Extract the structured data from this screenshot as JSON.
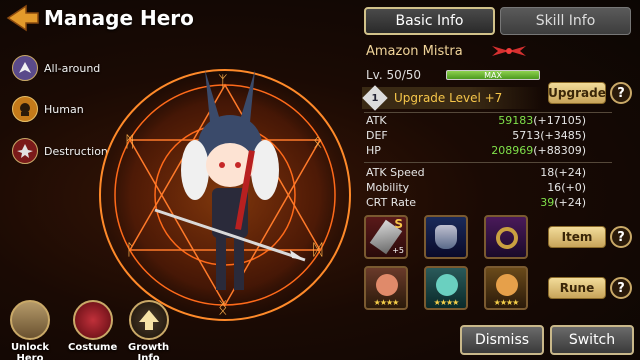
{
  "header": {
    "title": "Manage Hero"
  },
  "attributes": [
    {
      "label": "All-around",
      "icon": "wings-icon"
    },
    {
      "label": "Human",
      "icon": "human-head-icon"
    },
    {
      "label": "Destruction",
      "icon": "destruction-icon"
    }
  ],
  "bottom_buttons": [
    {
      "label": "Unlock\nHero",
      "icon": "lock-icon"
    },
    {
      "label": "Costume",
      "icon": "costume-icon"
    },
    {
      "label": "Growth\nInfo",
      "icon": "growth-arrow-icon"
    }
  ],
  "tabs": {
    "basic": "Basic Info",
    "skill": "Skill Info"
  },
  "hero": {
    "name": "Amazon Mistra",
    "level_label": "Lv. 50/50",
    "level_bar": {
      "text": "MAX",
      "fill": 1.0
    },
    "upgrade_badge": "1",
    "upgrade_level": "Upgrade Level +7",
    "upgrade_button": "Upgrade"
  },
  "stats_main": [
    {
      "name": "ATK",
      "value": "59183",
      "bonus": "(+17105)"
    },
    {
      "name": "DEF",
      "value": "5713",
      "bonus": "(+3485)"
    },
    {
      "name": "HP",
      "value": "208969",
      "bonus": "(+88309)"
    }
  ],
  "stats_secondary": [
    {
      "name": "ATK Speed",
      "value": "18",
      "bonus": "(+24)"
    },
    {
      "name": "Mobility",
      "value": "16",
      "bonus": "(+0)"
    },
    {
      "name": "CRT Rate",
      "value": "39",
      "bonus": "(+24)"
    }
  ],
  "items": {
    "button": "Item",
    "slots": [
      {
        "icon": "sword-item-icon",
        "rank": "S",
        "plus": "+5"
      },
      {
        "icon": "armor-item-icon",
        "rank": "",
        "plus": ""
      },
      {
        "icon": "ring-item-icon",
        "rank": "",
        "plus": ""
      }
    ]
  },
  "runes": {
    "button": "Rune",
    "slots": [
      {
        "icon": "rune-red-icon",
        "stars": "★★★★"
      },
      {
        "icon": "rune-teal-icon",
        "stars": "★★★★"
      },
      {
        "icon": "rune-orange-icon",
        "stars": "★★★★"
      }
    ]
  },
  "footer_buttons": {
    "dismiss": "Dismiss",
    "switch": "Switch"
  },
  "colors": {
    "accent_gold": "#f6c64a",
    "stat_green": "#7fe04a",
    "panel_border": "#c9b88a"
  }
}
